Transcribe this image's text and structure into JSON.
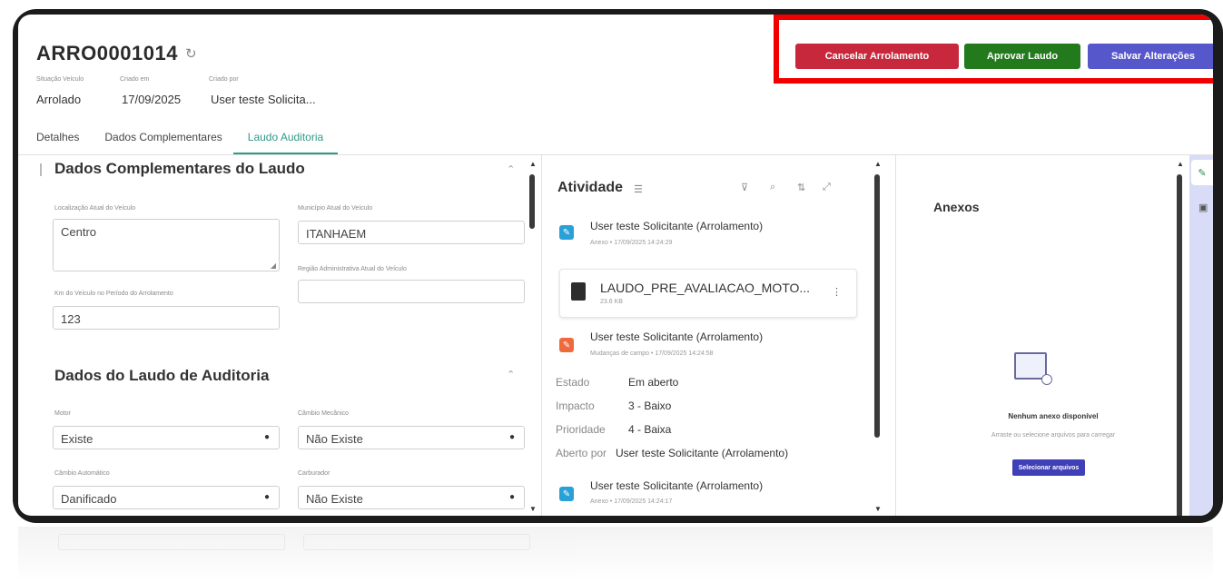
{
  "header": {
    "record_id": "ARRO0001014",
    "meta": [
      {
        "label": "Situação Veículo",
        "value": "Arrolado"
      },
      {
        "label": "Criado em",
        "value": "17/09/2025"
      },
      {
        "label": "Criado por",
        "value": "User teste Solicita..."
      }
    ]
  },
  "actions": {
    "cancel_label": "Cancelar Arrolamento",
    "approve_label": "Aprovar Laudo",
    "save_label": "Salvar Alterações"
  },
  "tabs": [
    {
      "label": "Detalhes",
      "active": false
    },
    {
      "label": "Dados Complementares",
      "active": false
    },
    {
      "label": "Laudo Auditoria",
      "active": true
    }
  ],
  "form": {
    "section1_title": "Dados Complementares do Laudo",
    "localizacao_label": "Localização Atual do Veículo",
    "localizacao_value": "Centro",
    "municipio_label": "Município Atual do Veículo",
    "municipio_value": "ITANHAEM",
    "regiao_label": "Região Administrativa Atual do Veículo",
    "regiao_value": "",
    "km_label": "Km do Veículo no Período do Arrolamento",
    "km_value": "123",
    "section2_title": "Dados do Laudo de Auditoria",
    "motor_label": "Motor",
    "motor_value": "Existe",
    "cambio_mec_label": "Câmbio Mecânico",
    "cambio_mec_value": "Não Existe",
    "cambio_auto_label": "Câmbio Automático",
    "cambio_auto_value": "Danificado",
    "carburador_label": "Carburador",
    "carburador_value": "Não Existe"
  },
  "activity": {
    "title": "Atividade",
    "entries": [
      {
        "author": "User teste Solicitante (Arrolamento)",
        "sub": "Anexo • 17/09/2025 14:24:29"
      },
      {
        "author": "User teste Solicitante (Arrolamento)",
        "sub": "Mudanças de campo • 17/09/2025 14:24:58"
      },
      {
        "author": "User teste Solicitante (Arrolamento)",
        "sub": "Anexo • 17/09/2025 14:24:17"
      }
    ],
    "attachment": {
      "name": "LAUDO_PRE_AVALIACAO_MOTO...",
      "size": "23.6 KB"
    },
    "fields": [
      {
        "label": "Estado",
        "value": "Em aberto"
      },
      {
        "label": "Impacto",
        "value": "3 - Baixo"
      },
      {
        "label": "Prioridade",
        "value": "4 - Baixa"
      },
      {
        "label": "Aberto por",
        "value": "User teste Solicitante (Arrolamento)"
      }
    ]
  },
  "attachments_panel": {
    "title": "Anexos",
    "empty_title": "Nenhum anexo disponível",
    "empty_sub": "Arraste ou selecione arquivos para carregar",
    "select_button": "Selecionar arquivos"
  },
  "colors": {
    "cancel": "#c8283c",
    "approve": "#237a1d",
    "save": "#5757cc",
    "tab_active": "#2f9a8a",
    "highlight": "#f20000"
  }
}
